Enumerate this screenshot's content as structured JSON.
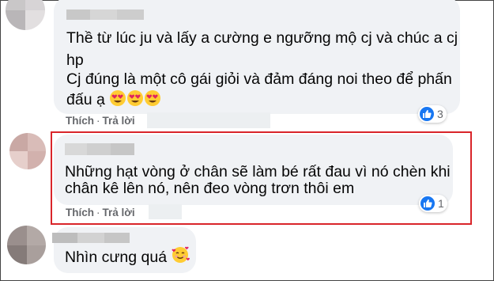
{
  "comments": [
    {
      "text_lines": [
        "Thề từ lúc ju và lấy a cường e ngưỡng mộ cj và chúc a cj",
        "hp",
        "Cj đúng là một cô gái giỏi và đảm đáng noi theo để phấn",
        "đấu ạ"
      ],
      "emoji_icons": [
        "heart-eyes-emoji",
        "heart-eyes-emoji",
        "heart-eyes-emoji"
      ],
      "actions": {
        "like": "Thích",
        "reply": "Trả lời",
        "separator": "·"
      },
      "reactions": {
        "icon": "like-icon",
        "count": "3"
      }
    },
    {
      "text_lines": [
        "Những hạt vòng ở chân sẽ làm bé rất đau vì nó chèn khi",
        "chân kê lên nó, nên đeo vòng trơn thôi em"
      ],
      "actions": {
        "like": "Thích",
        "reply": "Trả lời",
        "separator": "·"
      },
      "reactions": {
        "icon": "like-icon",
        "count": "1"
      },
      "highlighted": true
    },
    {
      "text_lines": [
        "Nhìn cưng quá"
      ],
      "emoji_icons": [
        "smiling-face-with-hearts-emoji"
      ]
    }
  ],
  "colors": {
    "bubble": "#f0f2f5",
    "action_text": "#65676b",
    "like_blue": "#1877f2",
    "highlight_border": "#d9252a"
  }
}
